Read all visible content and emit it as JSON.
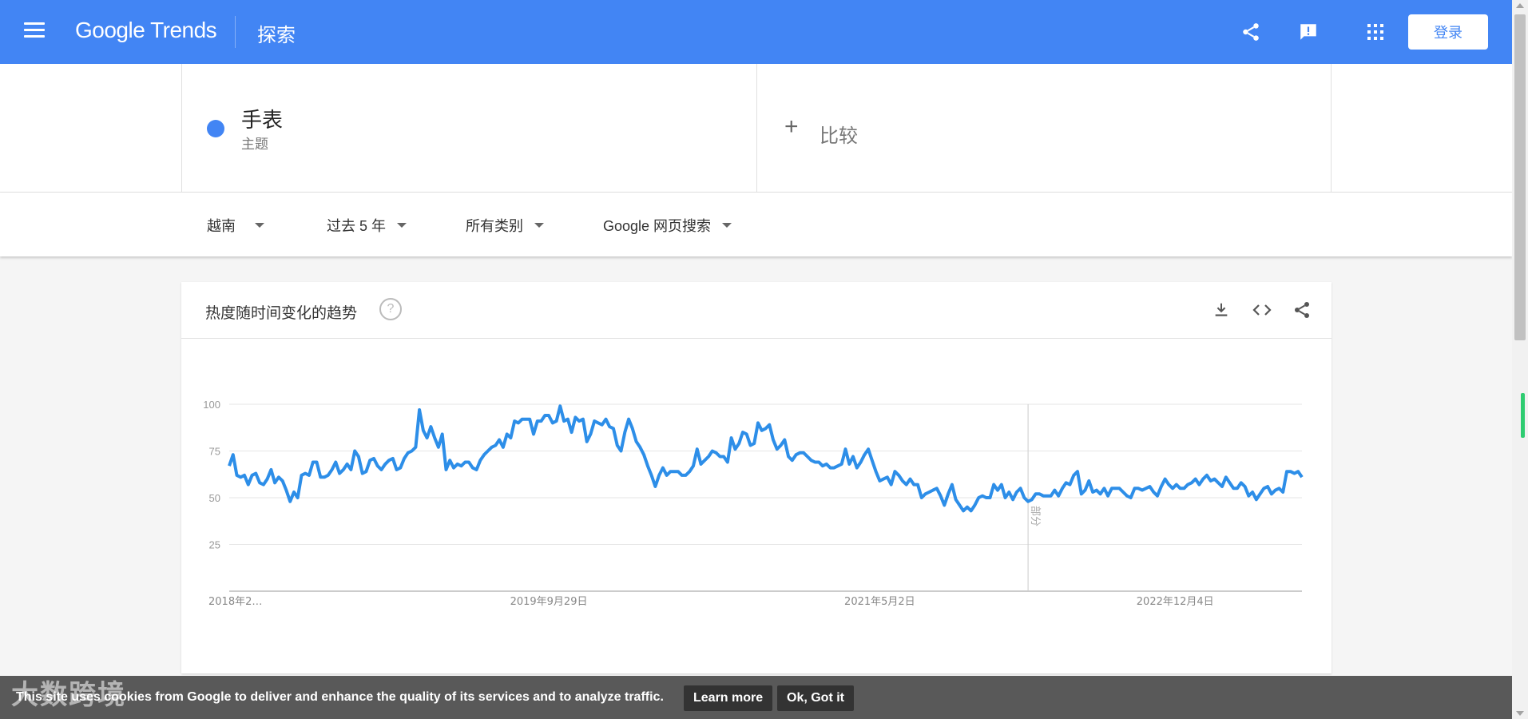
{
  "appbar": {
    "brand": "Google Trends",
    "title": "探索",
    "login_label": "登录",
    "color": "#4285f4"
  },
  "search": {
    "term": "手表",
    "term_type": "主题",
    "term_color": "#4285f4",
    "compare_label": "比较"
  },
  "filters": {
    "region": "越南",
    "time": "过去 5 年",
    "category": "所有类别",
    "property": "Google 网页搜索"
  },
  "card": {
    "title": "热度随时间变化的趋势",
    "help": "?"
  },
  "chart_data": {
    "type": "line",
    "color": "#2d8ee8",
    "ylim": [
      0,
      100
    ],
    "yticks": [
      25,
      50,
      75,
      100
    ],
    "x_tick_labels": [
      "2018年2…",
      "2019年9月29日",
      "2021年5月2日",
      "2022年12月4日"
    ],
    "x_tick_index": [
      0,
      84,
      171,
      258
    ],
    "partial_label": "部分",
    "partial_index": 210,
    "series": [
      {
        "values": [
          67,
          73,
          62,
          61,
          62,
          57,
          62,
          63,
          58,
          57,
          60,
          65,
          58,
          61,
          59,
          54,
          48,
          53,
          50,
          62,
          63,
          62,
          69,
          69,
          61,
          61,
          62,
          65,
          69,
          63,
          65,
          68,
          65,
          75,
          72,
          63,
          64,
          70,
          71,
          67,
          65,
          68,
          70,
          71,
          65,
          66,
          71,
          74,
          75,
          77,
          97,
          86,
          82,
          88,
          82,
          77,
          84,
          65,
          70,
          66,
          68,
          67,
          69,
          69,
          66,
          65,
          70,
          73,
          75,
          77,
          78,
          81,
          77,
          84,
          82,
          91,
          90,
          92,
          92,
          92,
          84,
          91,
          91,
          94,
          94,
          90,
          91,
          99,
          91,
          92,
          85,
          93,
          91,
          92,
          80,
          84,
          91,
          90,
          89,
          92,
          88,
          87,
          78,
          75,
          85,
          92,
          87,
          80,
          77,
          73,
          67,
          62,
          56,
          62,
          66,
          62,
          64,
          64,
          64,
          62,
          62,
          64,
          67,
          76,
          68,
          70,
          72,
          75,
          74,
          72,
          72,
          69,
          82,
          76,
          79,
          85,
          84,
          78,
          79,
          90,
          86,
          87,
          89,
          81,
          76,
          78,
          81,
          72,
          70,
          73,
          74,
          74,
          72,
          70,
          69,
          69,
          67,
          68,
          66,
          66,
          67,
          68,
          76,
          68,
          72,
          66,
          69,
          73,
          76,
          70,
          64,
          59,
          60,
          61,
          57,
          64,
          62,
          59,
          57,
          60,
          57,
          57,
          50,
          52,
          53,
          54,
          55,
          51,
          46,
          52,
          57,
          49,
          46,
          43,
          45,
          43,
          46,
          50,
          51,
          50,
          50,
          57,
          54,
          57,
          50,
          53,
          49,
          53,
          55,
          50,
          48,
          49,
          52,
          52,
          51,
          51,
          51,
          54,
          51,
          55,
          58,
          57,
          62,
          64,
          52,
          54,
          59,
          53,
          54,
          52,
          55,
          51,
          55,
          55,
          55,
          53,
          51,
          50,
          55,
          55,
          54,
          55,
          56,
          53,
          51,
          56,
          60,
          57,
          55,
          57,
          55,
          55,
          57,
          58,
          60,
          57,
          60,
          62,
          59,
          60,
          58,
          56,
          61,
          58,
          55,
          55,
          58,
          56,
          51,
          53,
          49,
          52,
          55,
          56,
          52,
          54,
          55,
          53,
          64,
          64,
          63,
          64,
          61
        ]
      }
    ]
  },
  "cookie": {
    "message": "This site uses cookies from Google to deliver and enhance the quality of its services and to analyze traffic.",
    "learn_more": "Learn more",
    "ok": "Ok, Got it"
  },
  "watermark": "大数跨境",
  "icons": [
    "menu-icon",
    "share-icon",
    "feedback-icon",
    "apps-icon",
    "download-icon",
    "embed-icon",
    "help-icon"
  ]
}
